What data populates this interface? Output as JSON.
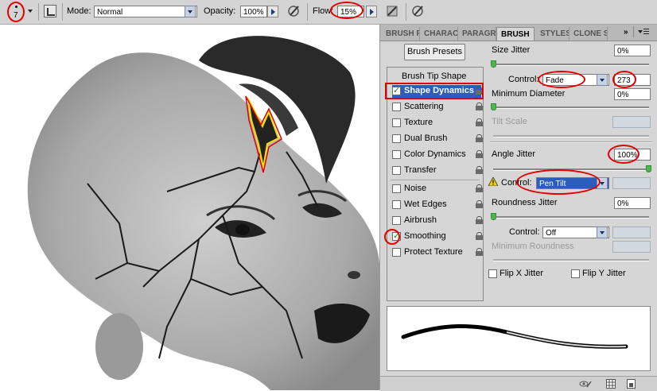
{
  "options_bar": {
    "brush_size": "7",
    "mode_label": "Mode:",
    "mode_value": "Normal",
    "opacity_label": "Opacity:",
    "opacity_value": "100%",
    "flow_label": "Flow:",
    "flow_value": "15%"
  },
  "panel": {
    "tabs": [
      {
        "label": "BRUSH PRESETS"
      },
      {
        "label": "CHARACTER"
      },
      {
        "label": "PARAGRAPH"
      },
      {
        "label": "BRUSH"
      },
      {
        "label": "STYLES"
      },
      {
        "label": "CLONE SOURCE"
      }
    ],
    "brush_presets_button": "Brush Presets",
    "list_header": "Brush Tip Shape",
    "items": [
      {
        "label": "Shape Dynamics",
        "checked": true
      },
      {
        "label": "Scattering",
        "checked": false
      },
      {
        "label": "Texture",
        "checked": false
      },
      {
        "label": "Dual Brush",
        "checked": false
      },
      {
        "label": "Color Dynamics",
        "checked": false
      },
      {
        "label": "Transfer",
        "checked": false
      },
      {
        "label": "Noise",
        "checked": false
      },
      {
        "label": "Wet Edges",
        "checked": false
      },
      {
        "label": "Airbrush",
        "checked": false
      },
      {
        "label": "Smoothing",
        "checked": true
      },
      {
        "label": "Protect Texture",
        "checked": false
      }
    ],
    "size_jitter_label": "Size Jitter",
    "size_jitter_value": "0%",
    "control_label": "Control:",
    "control_value": "Fade",
    "fade_steps": "273",
    "min_diameter_label": "Minimum Diameter",
    "min_diameter_value": "0%",
    "tilt_scale_label": "Tilt Scale",
    "angle_jitter_label": "Angle Jitter",
    "angle_jitter_value": "100%",
    "angle_control_label": "Control:",
    "angle_control_value": "Pen Tilt",
    "roundness_jitter_label": "Roundness Jitter",
    "roundness_jitter_value": "0%",
    "roundness_control_label": "Control:",
    "roundness_control_value": "Off",
    "min_roundness_label": "Minimum Roundness",
    "flip_x_label": "Flip X Jitter",
    "flip_y_label": "Flip Y Jitter"
  }
}
